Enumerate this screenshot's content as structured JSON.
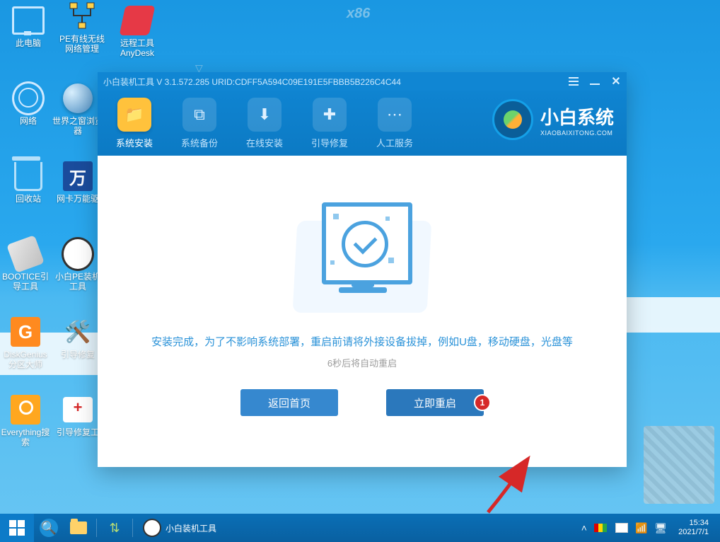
{
  "badges": {
    "arch": "x86"
  },
  "desktop_icons": [
    {
      "id": "this-pc",
      "label": "此电脑"
    },
    {
      "id": "pe-net",
      "label": "PE有线无线网络管理"
    },
    {
      "id": "anydesk",
      "label": "远程工具AnyDesk"
    },
    {
      "id": "network",
      "label": "网络"
    },
    {
      "id": "world-browser",
      "label": "世界之窗浏览器"
    },
    {
      "id": "recycle",
      "label": "回收站"
    },
    {
      "id": "wan-driver",
      "label": "网卡万能驱"
    },
    {
      "id": "bootice",
      "label": "BOOTICE引导工具"
    },
    {
      "id": "xiaobai-pe",
      "label": "小白PE装机工具"
    },
    {
      "id": "diskgenius",
      "label": "DiskGenius分区大师"
    },
    {
      "id": "boot-repair",
      "label": "引导修复"
    },
    {
      "id": "everything",
      "label": "Everything搜索"
    },
    {
      "id": "boot-repair-tool",
      "label": "引导修复工"
    }
  ],
  "window": {
    "title": "小白装机工具 V 3.1.572.285 URID:CDFF5A594C09E191E5FBBB5B226C4C44",
    "nav": [
      {
        "id": "install",
        "label": "系统安装",
        "active": true
      },
      {
        "id": "backup",
        "label": "系统备份"
      },
      {
        "id": "online",
        "label": "在线安装"
      },
      {
        "id": "bootfix",
        "label": "引导修复"
      },
      {
        "id": "manual",
        "label": "人工服务"
      }
    ],
    "logo": {
      "title": "小白系统",
      "sub": "XIAOBAIXITONG.COM"
    },
    "message_primary": "安装完成，为了不影响系统部署，重启前请将外接设备拔掉，例如U盘，移动硬盘，光盘等",
    "message_secondary": "6秒后将自动重启",
    "buttons": {
      "back": "返回首页",
      "restart": "立即重启"
    },
    "annotation_badge": "1"
  },
  "taskbar": {
    "app": {
      "label": "小白装机工具"
    },
    "clock": {
      "time": "15:34",
      "date": "2021/7/1"
    }
  }
}
